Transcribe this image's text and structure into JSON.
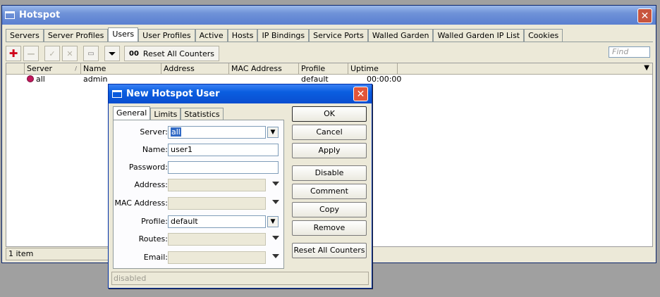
{
  "window": {
    "title": "Hotspot",
    "tabs": [
      "Servers",
      "Server Profiles",
      "Users",
      "User Profiles",
      "Active",
      "Hosts",
      "IP Bindings",
      "Service Ports",
      "Walled Garden",
      "Walled Garden IP List",
      "Cookies"
    ],
    "active_tab": "Users",
    "toolbar": {
      "reset_label": "Reset All Counters",
      "reset_icon_text": "00",
      "find_placeholder": "Find"
    },
    "table": {
      "columns": [
        "Server",
        "Name",
        "Address",
        "MAC Address",
        "Profile",
        "Uptime"
      ],
      "rows": [
        {
          "server": "all",
          "name": "admin",
          "address": "",
          "mac": "",
          "profile": "default",
          "uptime": "00:00:00"
        }
      ]
    },
    "status": "1 item"
  },
  "dialog": {
    "title": "New Hotspot User",
    "tabs": [
      "General",
      "Limits",
      "Statistics"
    ],
    "fields": {
      "server": {
        "label": "Server:",
        "value": "all"
      },
      "name": {
        "label": "Name:",
        "value": "user1"
      },
      "password": {
        "label": "Password:",
        "value": ""
      },
      "address": {
        "label": "Address:",
        "value": ""
      },
      "mac": {
        "label": "MAC Address:",
        "value": ""
      },
      "profile": {
        "label": "Profile:",
        "value": "default"
      },
      "routes": {
        "label": "Routes:",
        "value": ""
      },
      "email": {
        "label": "Email:",
        "value": ""
      }
    },
    "buttons": [
      "OK",
      "Cancel",
      "Apply",
      "Disable",
      "Comment",
      "Copy",
      "Remove",
      "Reset All Counters"
    ],
    "status": "disabled"
  },
  "colors": {
    "title_bar": "#0a5ee0",
    "selection": "#316ac5",
    "close": "#e2563a"
  }
}
